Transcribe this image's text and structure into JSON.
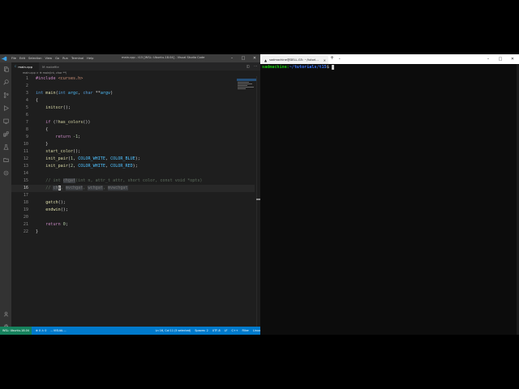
{
  "vscode": {
    "menu": [
      "File",
      "Edit",
      "Selection",
      "View",
      "Go",
      "Run",
      "Terminal",
      "Help"
    ],
    "window_title": "main.cpp - t15 [WSL: Ubuntu-18.04] - Visual Studio Code",
    "tabs": [
      {
        "label": "main.cpp"
      },
      {
        "label": "M  makefile"
      }
    ],
    "breadcrumb": "main.cpp > ⊕ main(int, char **)",
    "code_lines": [
      {
        "n": "1",
        "tokens": [
          {
            "t": "#include ",
            "c": "kw"
          },
          {
            "t": "<curses.h>",
            "c": "str"
          }
        ]
      },
      {
        "n": "2",
        "tokens": []
      },
      {
        "n": "3",
        "tokens": [
          {
            "t": "int ",
            "c": "ty"
          },
          {
            "t": "main",
            "c": "fn"
          },
          {
            "t": "(",
            "c": "plain"
          },
          {
            "t": "int ",
            "c": "ty"
          },
          {
            "t": "argc",
            "c": "mac"
          },
          {
            "t": ", ",
            "c": "plain"
          },
          {
            "t": "char ",
            "c": "ty"
          },
          {
            "t": "**",
            "c": "plain"
          },
          {
            "t": "argv",
            "c": "mac"
          },
          {
            "t": ")",
            "c": "plain"
          }
        ]
      },
      {
        "n": "4",
        "tokens": [
          {
            "t": "{",
            "c": "plain"
          }
        ]
      },
      {
        "n": "5",
        "tokens": [
          {
            "t": "    ",
            "c": "plain"
          },
          {
            "t": "initscr",
            "c": "fn"
          },
          {
            "t": "();",
            "c": "plain"
          }
        ]
      },
      {
        "n": "6",
        "tokens": []
      },
      {
        "n": "7",
        "tokens": [
          {
            "t": "    ",
            "c": "plain"
          },
          {
            "t": "if ",
            "c": "kw"
          },
          {
            "t": "(!",
            "c": "plain"
          },
          {
            "t": "has_colors",
            "c": "fn"
          },
          {
            "t": "())",
            "c": "plain"
          }
        ]
      },
      {
        "n": "8",
        "tokens": [
          {
            "t": "    {",
            "c": "plain"
          }
        ]
      },
      {
        "n": "9",
        "tokens": [
          {
            "t": "        ",
            "c": "plain"
          },
          {
            "t": "return ",
            "c": "kw"
          },
          {
            "t": "-1",
            "c": "num"
          },
          {
            "t": ";",
            "c": "plain"
          }
        ]
      },
      {
        "n": "10",
        "tokens": [
          {
            "t": "    }",
            "c": "plain"
          }
        ]
      },
      {
        "n": "11",
        "tokens": [
          {
            "t": "    ",
            "c": "plain"
          },
          {
            "t": "start_color",
            "c": "fn"
          },
          {
            "t": "();",
            "c": "plain"
          }
        ]
      },
      {
        "n": "12",
        "tokens": [
          {
            "t": "    ",
            "c": "plain"
          },
          {
            "t": "init_pair",
            "c": "fn"
          },
          {
            "t": "(",
            "c": "plain"
          },
          {
            "t": "1",
            "c": "num"
          },
          {
            "t": ", ",
            "c": "plain"
          },
          {
            "t": "COLOR_WHITE",
            "c": "mac"
          },
          {
            "t": ", ",
            "c": "plain"
          },
          {
            "t": "COLOR_BLUE",
            "c": "mac"
          },
          {
            "t": ");",
            "c": "plain"
          }
        ]
      },
      {
        "n": "13",
        "tokens": [
          {
            "t": "    ",
            "c": "plain"
          },
          {
            "t": "init_pair",
            "c": "fn"
          },
          {
            "t": "(",
            "c": "plain"
          },
          {
            "t": "2",
            "c": "num"
          },
          {
            "t": ", ",
            "c": "plain"
          },
          {
            "t": "COLOR_WHITE",
            "c": "mac"
          },
          {
            "t": ", ",
            "c": "plain"
          },
          {
            "t": "COLOR_RED",
            "c": "mac"
          },
          {
            "t": ");",
            "c": "plain"
          }
        ]
      },
      {
        "n": "14",
        "tokens": []
      },
      {
        "n": "15",
        "tokens": [
          {
            "t": "    // int ",
            "c": "cm-dim"
          },
          {
            "t": "chgat",
            "c": "hl-ph"
          },
          {
            "t": "(int n, attr_t attr, short color, const void *opts)",
            "c": "cm-dim"
          }
        ]
      },
      {
        "n": "16",
        "current": true,
        "tokens": [
          {
            "t": "    // ",
            "c": "cm-dim"
          },
          {
            "t": "ch",
            "c": "hl-ph"
          },
          {
            "t": "g",
            "c": "cursor-box"
          },
          {
            "t": ", ",
            "c": "cm-dim"
          },
          {
            "t": "mvchgat",
            "c": "hl-ph"
          },
          {
            "t": ", ",
            "c": "cm-dim"
          },
          {
            "t": "wchgat",
            "c": "hl-ph"
          },
          {
            "t": ", ",
            "c": "cm-dim"
          },
          {
            "t": "mvwchgat",
            "c": "hl-ph"
          }
        ]
      },
      {
        "n": "17",
        "tokens": []
      },
      {
        "n": "18",
        "tokens": [
          {
            "t": "    ",
            "c": "plain"
          },
          {
            "t": "getch",
            "c": "fn"
          },
          {
            "t": "();",
            "c": "plain"
          }
        ]
      },
      {
        "n": "19",
        "tokens": [
          {
            "t": "    ",
            "c": "plain"
          },
          {
            "t": "endwin",
            "c": "fn"
          },
          {
            "t": "();",
            "c": "plain"
          }
        ]
      },
      {
        "n": "20",
        "tokens": []
      },
      {
        "n": "21",
        "tokens": [
          {
            "t": "    ",
            "c": "plain"
          },
          {
            "t": "return ",
            "c": "kw"
          },
          {
            "t": "0",
            "c": "num"
          },
          {
            "t": ";",
            "c": "plain"
          }
        ]
      },
      {
        "n": "22",
        "tokens": [
          {
            "t": "}",
            "c": "plain"
          }
        ]
      }
    ],
    "status": {
      "remote": "WSL: Ubuntu-18.04",
      "problems": "⊗ 0 ⚠ 0",
      "extension": "-- VISUAL --",
      "position": "Ln 16, Col 11 (5 selected)",
      "spaces": "Spaces: 2",
      "encoding": "UTF-8",
      "eol": "LF",
      "language": "C++",
      "filter": "Filter",
      "os": "Linux"
    }
  },
  "terminal": {
    "tab_title": "sadmachine@DELL-G5: ~/tutori…",
    "prompt": {
      "user": "sadmachine:",
      "path": "~/tutorials/t15",
      "sign": "$"
    }
  },
  "colors": {
    "vscode_bg": "#1e1e1e",
    "statusbar": "#007acc",
    "terminal_bg": "#0c0c0c",
    "prompt_green": "#16c60c",
    "prompt_blue": "#3b78ff"
  }
}
